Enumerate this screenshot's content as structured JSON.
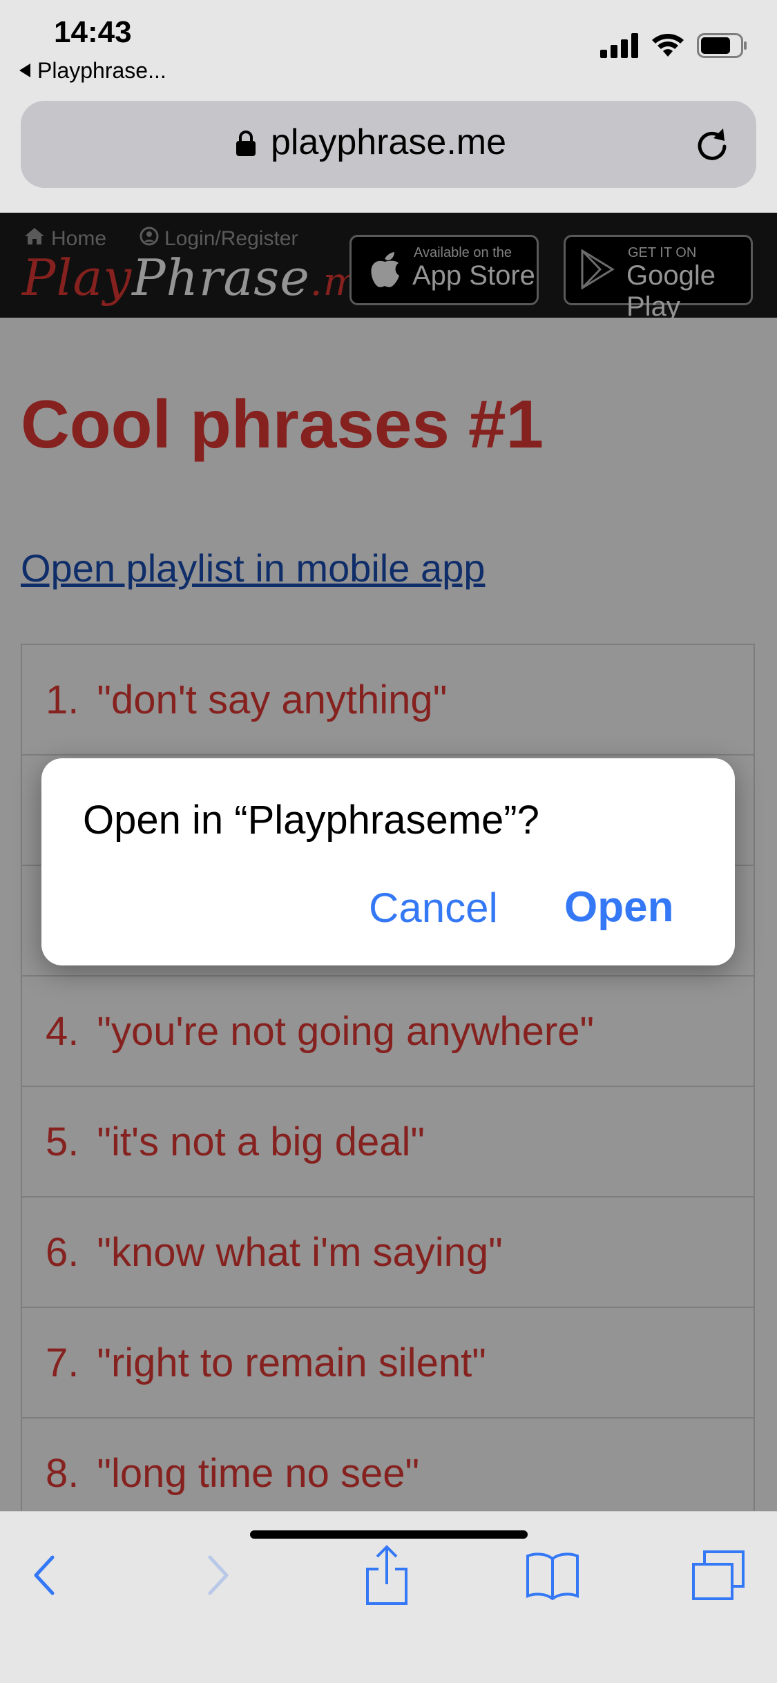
{
  "status_bar": {
    "time": "14:43",
    "back_app_label": "Playphrase..."
  },
  "browser": {
    "url": "playphrase.me"
  },
  "site_header": {
    "home_label": "Home",
    "login_label": "Login/Register",
    "logo": {
      "play": "Play",
      "phrase": "Phrase",
      "me": ".me"
    },
    "app_store": {
      "small": "Available on the",
      "big": "App Store"
    },
    "google_play": {
      "small": "GET IT ON",
      "big": "Google Play"
    }
  },
  "page": {
    "title": "Cool phrases #1",
    "playlist_link": "Open playlist in mobile app",
    "phrases": [
      {
        "num": "1.",
        "text": "\"don't say anything\""
      },
      {
        "num": "",
        "text": ""
      },
      {
        "num": "",
        "text": ""
      },
      {
        "num": "4.",
        "text": "\"you're not going anywhere\""
      },
      {
        "num": "5.",
        "text": "\"it's not a big deal\""
      },
      {
        "num": "6.",
        "text": "\"know what i'm saying\""
      },
      {
        "num": "7.",
        "text": "\"right to remain silent\""
      },
      {
        "num": "8.",
        "text": "\"long time no see\""
      }
    ]
  },
  "dialog": {
    "message": "Open in “Playphraseme”?",
    "cancel_label": "Cancel",
    "open_label": "Open"
  },
  "colors": {
    "accent_red": "#e53935",
    "link_blue": "#1a4fb5",
    "ios_blue": "#3478f6"
  }
}
